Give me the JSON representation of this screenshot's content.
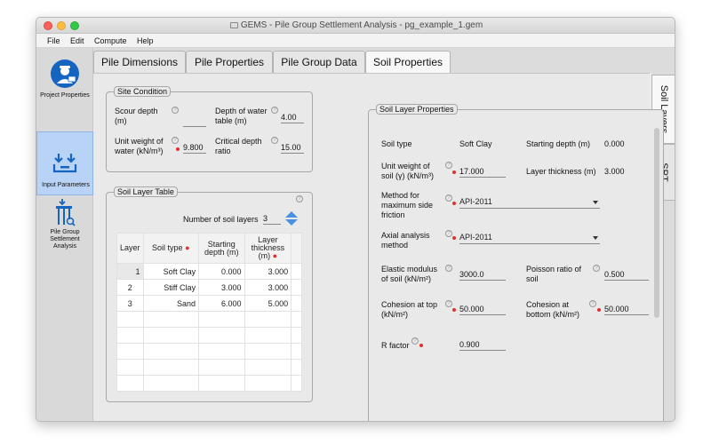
{
  "window": {
    "title": "GEMS - Pile Group Settlement Analysis - pg_example_1.gem"
  },
  "menu": [
    "File",
    "Edit",
    "Compute",
    "Help"
  ],
  "sidebar": [
    {
      "label": "Project Properties",
      "icon": "engineer-icon"
    },
    {
      "label": "Input Parameters",
      "icon": "input-icon"
    },
    {
      "label": "Pile Group Settlement Analysis",
      "icon": "pile-group-icon"
    }
  ],
  "tabs": [
    "Pile Dimensions",
    "Pile Properties",
    "Pile Group Data",
    "Soil Properties"
  ],
  "vtabs": [
    "Soil Layers",
    "SPT"
  ],
  "site": {
    "title": "Site Condition",
    "scour_label": "Scour depth (m)",
    "scour_value": "",
    "water_depth_label": "Depth of water table (m)",
    "water_depth_value": "4.00",
    "unit_weight_label": "Unit weight of water (kN/m³)",
    "unit_weight_value": "9.800",
    "critical_label": "Critical depth ratio",
    "critical_value": "15.00"
  },
  "soil_table": {
    "title": "Soil Layer Table",
    "num_label": "Number of soil layers",
    "num_value": "3",
    "headers": [
      "Layer",
      "Soil type",
      "Starting depth (m)",
      "Layer thickness (m)"
    ],
    "rows": [
      [
        "1",
        "Soft Clay",
        "0.000",
        "3.000"
      ],
      [
        "2",
        "Stiff Clay",
        "3.000",
        "3.000"
      ],
      [
        "3",
        "Sand",
        "6.000",
        "5.000"
      ]
    ]
  },
  "props": {
    "title": "Soil Layer Properties",
    "soil_type_label": "Soil type",
    "soil_type_value": "Soft Clay",
    "start_depth_label": "Starting depth (m)",
    "start_depth_value": "0.000",
    "unit_weight_label": "Unit weight of soil (γ) (kN/m³)",
    "unit_weight_value": "17.000",
    "thickness_label": "Layer thickness (m)",
    "thickness_value": "3.000",
    "method_label": "Method for maximum side friction",
    "method_value": "API-2011",
    "axial_label": "Axial analysis method",
    "axial_value": "API-2011",
    "elastic_label": "Elastic modulus of soil (kN/m²)",
    "elastic_value": "3000.0",
    "poisson_label": "Poisson ratio of soil",
    "poisson_value": "0.500",
    "coh_top_label": "Cohesion at top (kN/m²)",
    "coh_top_value": "50.000",
    "coh_bot_label": "Cohesion at bottom (kN/m²)",
    "coh_bot_value": "50.000",
    "r_label": "R factor",
    "r_value": "0.900"
  },
  "colors": {
    "accent": "#4a90e2",
    "required": "#e03030",
    "active_sidebar": "#b8d3f5"
  }
}
